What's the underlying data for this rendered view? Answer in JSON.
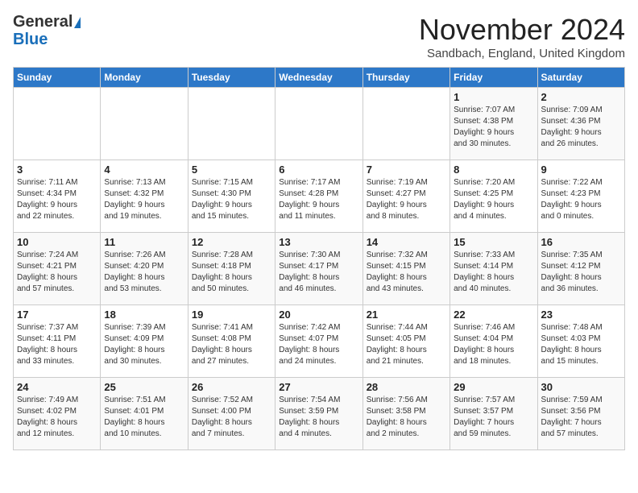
{
  "header": {
    "logo_general": "General",
    "logo_blue": "Blue",
    "title": "November 2024",
    "location": "Sandbach, England, United Kingdom"
  },
  "days_of_week": [
    "Sunday",
    "Monday",
    "Tuesday",
    "Wednesday",
    "Thursday",
    "Friday",
    "Saturday"
  ],
  "weeks": [
    [
      {
        "day": "",
        "info": ""
      },
      {
        "day": "",
        "info": ""
      },
      {
        "day": "",
        "info": ""
      },
      {
        "day": "",
        "info": ""
      },
      {
        "day": "",
        "info": ""
      },
      {
        "day": "1",
        "info": "Sunrise: 7:07 AM\nSunset: 4:38 PM\nDaylight: 9 hours\nand 30 minutes."
      },
      {
        "day": "2",
        "info": "Sunrise: 7:09 AM\nSunset: 4:36 PM\nDaylight: 9 hours\nand 26 minutes."
      }
    ],
    [
      {
        "day": "3",
        "info": "Sunrise: 7:11 AM\nSunset: 4:34 PM\nDaylight: 9 hours\nand 22 minutes."
      },
      {
        "day": "4",
        "info": "Sunrise: 7:13 AM\nSunset: 4:32 PM\nDaylight: 9 hours\nand 19 minutes."
      },
      {
        "day": "5",
        "info": "Sunrise: 7:15 AM\nSunset: 4:30 PM\nDaylight: 9 hours\nand 15 minutes."
      },
      {
        "day": "6",
        "info": "Sunrise: 7:17 AM\nSunset: 4:28 PM\nDaylight: 9 hours\nand 11 minutes."
      },
      {
        "day": "7",
        "info": "Sunrise: 7:19 AM\nSunset: 4:27 PM\nDaylight: 9 hours\nand 8 minutes."
      },
      {
        "day": "8",
        "info": "Sunrise: 7:20 AM\nSunset: 4:25 PM\nDaylight: 9 hours\nand 4 minutes."
      },
      {
        "day": "9",
        "info": "Sunrise: 7:22 AM\nSunset: 4:23 PM\nDaylight: 9 hours\nand 0 minutes."
      }
    ],
    [
      {
        "day": "10",
        "info": "Sunrise: 7:24 AM\nSunset: 4:21 PM\nDaylight: 8 hours\nand 57 minutes."
      },
      {
        "day": "11",
        "info": "Sunrise: 7:26 AM\nSunset: 4:20 PM\nDaylight: 8 hours\nand 53 minutes."
      },
      {
        "day": "12",
        "info": "Sunrise: 7:28 AM\nSunset: 4:18 PM\nDaylight: 8 hours\nand 50 minutes."
      },
      {
        "day": "13",
        "info": "Sunrise: 7:30 AM\nSunset: 4:17 PM\nDaylight: 8 hours\nand 46 minutes."
      },
      {
        "day": "14",
        "info": "Sunrise: 7:32 AM\nSunset: 4:15 PM\nDaylight: 8 hours\nand 43 minutes."
      },
      {
        "day": "15",
        "info": "Sunrise: 7:33 AM\nSunset: 4:14 PM\nDaylight: 8 hours\nand 40 minutes."
      },
      {
        "day": "16",
        "info": "Sunrise: 7:35 AM\nSunset: 4:12 PM\nDaylight: 8 hours\nand 36 minutes."
      }
    ],
    [
      {
        "day": "17",
        "info": "Sunrise: 7:37 AM\nSunset: 4:11 PM\nDaylight: 8 hours\nand 33 minutes."
      },
      {
        "day": "18",
        "info": "Sunrise: 7:39 AM\nSunset: 4:09 PM\nDaylight: 8 hours\nand 30 minutes."
      },
      {
        "day": "19",
        "info": "Sunrise: 7:41 AM\nSunset: 4:08 PM\nDaylight: 8 hours\nand 27 minutes."
      },
      {
        "day": "20",
        "info": "Sunrise: 7:42 AM\nSunset: 4:07 PM\nDaylight: 8 hours\nand 24 minutes."
      },
      {
        "day": "21",
        "info": "Sunrise: 7:44 AM\nSunset: 4:05 PM\nDaylight: 8 hours\nand 21 minutes."
      },
      {
        "day": "22",
        "info": "Sunrise: 7:46 AM\nSunset: 4:04 PM\nDaylight: 8 hours\nand 18 minutes."
      },
      {
        "day": "23",
        "info": "Sunrise: 7:48 AM\nSunset: 4:03 PM\nDaylight: 8 hours\nand 15 minutes."
      }
    ],
    [
      {
        "day": "24",
        "info": "Sunrise: 7:49 AM\nSunset: 4:02 PM\nDaylight: 8 hours\nand 12 minutes."
      },
      {
        "day": "25",
        "info": "Sunrise: 7:51 AM\nSunset: 4:01 PM\nDaylight: 8 hours\nand 10 minutes."
      },
      {
        "day": "26",
        "info": "Sunrise: 7:52 AM\nSunset: 4:00 PM\nDaylight: 8 hours\nand 7 minutes."
      },
      {
        "day": "27",
        "info": "Sunrise: 7:54 AM\nSunset: 3:59 PM\nDaylight: 8 hours\nand 4 minutes."
      },
      {
        "day": "28",
        "info": "Sunrise: 7:56 AM\nSunset: 3:58 PM\nDaylight: 8 hours\nand 2 minutes."
      },
      {
        "day": "29",
        "info": "Sunrise: 7:57 AM\nSunset: 3:57 PM\nDaylight: 7 hours\nand 59 minutes."
      },
      {
        "day": "30",
        "info": "Sunrise: 7:59 AM\nSunset: 3:56 PM\nDaylight: 7 hours\nand 57 minutes."
      }
    ]
  ]
}
